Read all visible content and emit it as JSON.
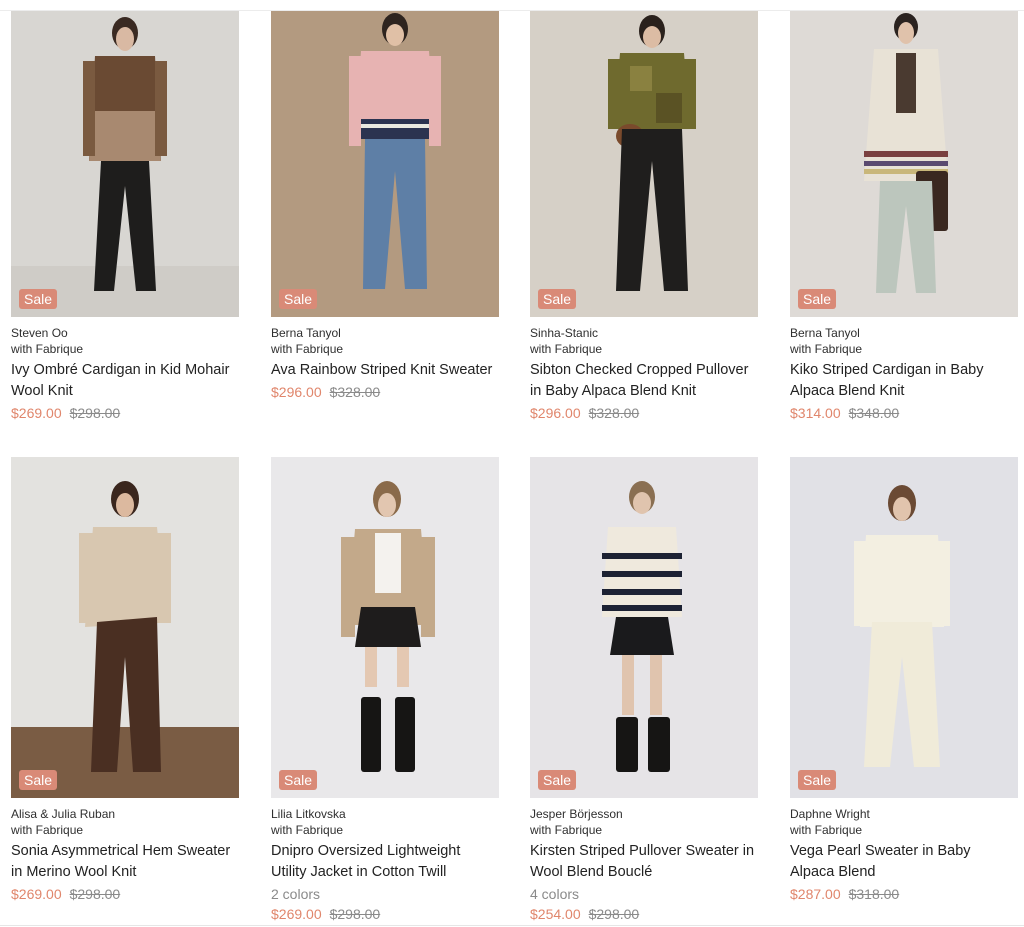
{
  "sale_badge": "Sale",
  "collab_label": "with Fabrique",
  "colors": {
    "sale": "#e0866c",
    "badge": "#d98a77",
    "muted": "#8a8a8a"
  },
  "products": [
    {
      "designer": "Steven Oo",
      "name": "Ivy Ombré Cardigan in Kid Mohair Wool Knit",
      "sale_price": "$269.00",
      "original_price": "$298.00"
    },
    {
      "designer": "Berna Tanyol",
      "name": "Ava Rainbow Striped Knit Sweater",
      "sale_price": "$296.00",
      "original_price": "$328.00"
    },
    {
      "designer": "Sinha-Stanic",
      "name": "Sibton Checked Cropped Pullover in Baby Alpaca Blend Knit",
      "sale_price": "$296.00",
      "original_price": "$328.00"
    },
    {
      "designer": "Berna Tanyol",
      "name": "Kiko Striped Cardigan in Baby Alpaca Blend Knit",
      "sale_price": "$314.00",
      "original_price": "$348.00"
    },
    {
      "designer": "Alisa & Julia Ruban",
      "name": "Sonia Asymmetrical Hem Sweater in Merino Wool Knit",
      "sale_price": "$269.00",
      "original_price": "$298.00"
    },
    {
      "designer": "Lilia Litkovska",
      "name": "Dnipro Oversized Lightweight Utility Jacket in Cotton Twill",
      "colors_count": "2 colors",
      "sale_price": "$269.00",
      "original_price": "$298.00"
    },
    {
      "designer": "Jesper Börjesson",
      "name": "Kirsten Striped Pullover Sweater in Wool Blend Bouclé",
      "colors_count": "4 colors",
      "sale_price": "$254.00",
      "original_price": "$298.00"
    },
    {
      "designer": "Daphne Wright",
      "name": "Vega Pearl Sweater in Baby Alpaca Blend",
      "sale_price": "$287.00",
      "original_price": "$318.00"
    }
  ]
}
